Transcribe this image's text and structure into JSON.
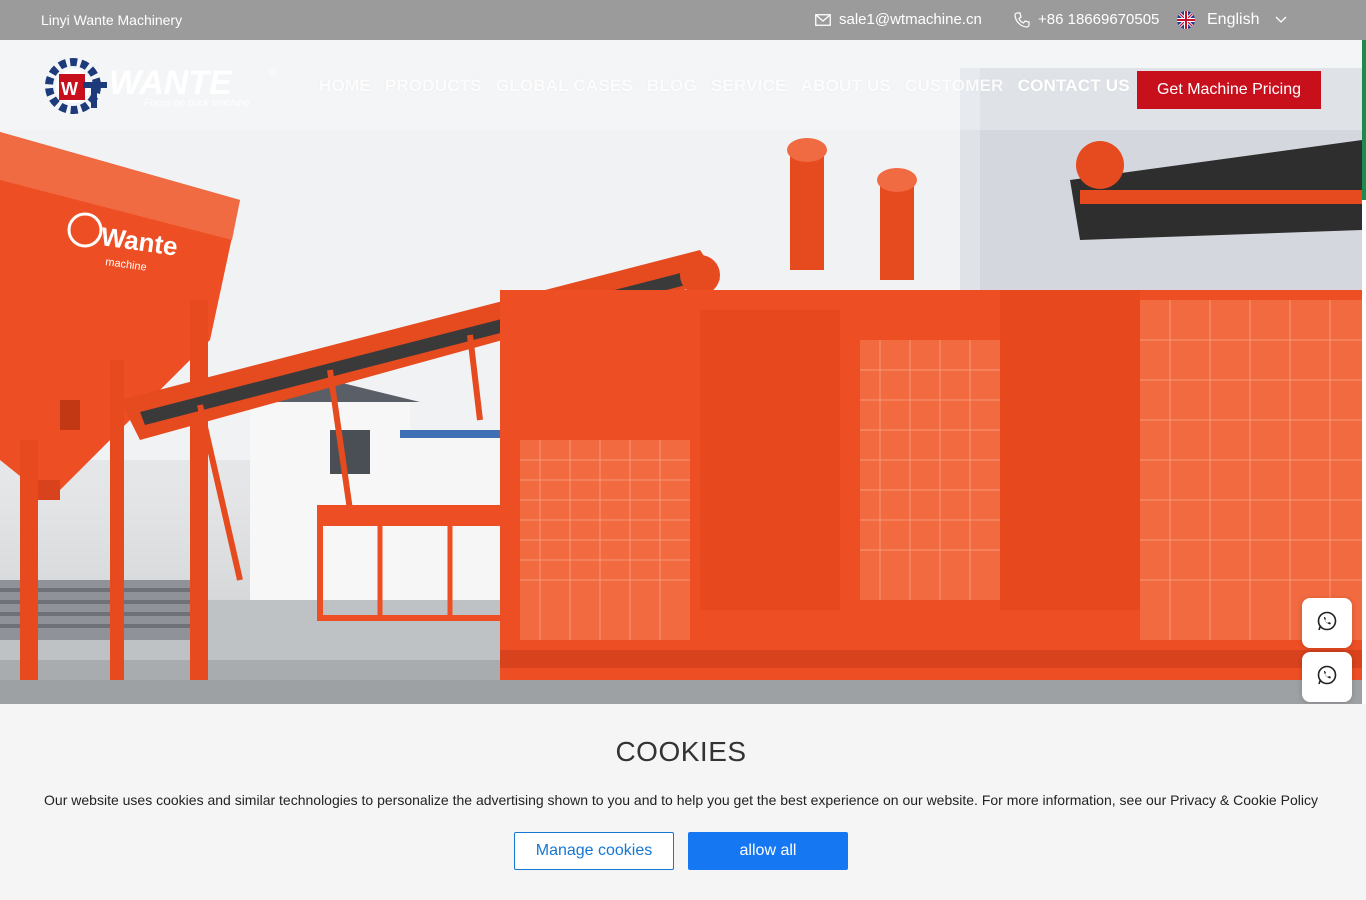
{
  "topbar": {
    "company": "Linyi Wante Machinery",
    "email": "sale1@wtmachine.cn",
    "phone": "+86 18669670505",
    "language": "English"
  },
  "header": {
    "logo_text": "WANTE",
    "logo_tagline": "Focus on brick machine",
    "logo_mark": "®",
    "nav": [
      "HOME",
      "PRODUCTS",
      "GLOBAL CASES",
      "BLOG",
      "SERVICE",
      "ABOUT US",
      "CUSTOMER",
      "CONTACT US"
    ],
    "cta_label": "Get Machine Pricing"
  },
  "hero": {
    "hopper_brand": "Wante",
    "hopper_sub": "machine"
  },
  "cookie": {
    "title": "COOKIES",
    "text": "Our website uses cookies and similar technologies to personalize the advertising shown to you and to help you get the best experience on our website. For more information, see our Privacy & Cookie Policy",
    "manage_label": "Manage cookies",
    "allow_label": "allow all"
  },
  "colors": {
    "accent_red": "#c8101d",
    "machine_orange": "#ef4a1f",
    "cookie_blue": "#1677f2"
  },
  "icons": [
    "mail-icon",
    "phone-icon",
    "uk-flag-icon",
    "chevron-down-icon",
    "whatsapp-icon"
  ]
}
